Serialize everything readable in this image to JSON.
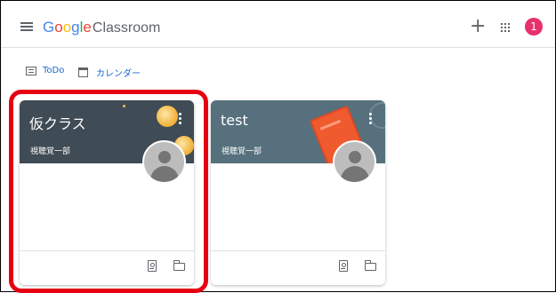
{
  "header": {
    "logo_google": [
      {
        "ch": "G",
        "color": "#4285f4"
      },
      {
        "ch": "o",
        "color": "#ea4335"
      },
      {
        "ch": "o",
        "color": "#fbbc05"
      },
      {
        "ch": "g",
        "color": "#4285f4"
      },
      {
        "ch": "l",
        "color": "#34a853"
      },
      {
        "ch": "e",
        "color": "#ea4335"
      }
    ],
    "logo_product": "Classroom",
    "add_label": "+",
    "account_initial": "1",
    "account_color": "#e8306a"
  },
  "subnav": {
    "todo_label": "ToDo",
    "calendar_label": "カレンダー",
    "link_color": "#1967d2"
  },
  "cards": [
    {
      "title": "仮クラス",
      "teacher": "視聴覚一部",
      "banner_color": "#3f4b55"
    },
    {
      "title": "test",
      "teacher": "視聴覚一部",
      "banner_color": "#56707d"
    }
  ],
  "icons": {
    "menu": "hamburger-menu-icon",
    "apps": "apps-grid-icon",
    "todo": "todo-list-icon",
    "calendar": "calendar-icon",
    "assignment": "assignment-icon",
    "folder": "folder-icon",
    "more": "more-vert-icon"
  },
  "highlight_color": "#e60012"
}
